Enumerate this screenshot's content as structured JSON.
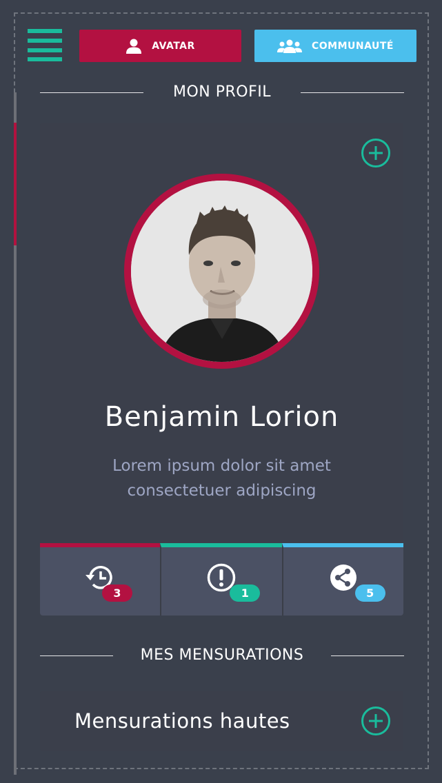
{
  "topbar": {
    "avatar_label": "AVATAR",
    "community_label": "COMMUNAUTÉ"
  },
  "profile": {
    "section_title": "MON PROFIL",
    "name": "Benjamin Lorion",
    "bio_line1": "Lorem ipsum dolor sit amet",
    "bio_line2": "consectetuer adipiscing"
  },
  "stats": [
    {
      "icon": "history-icon",
      "count": "3",
      "color": "#b31141"
    },
    {
      "icon": "alert-icon",
      "count": "1",
      "color": "#1abc9c"
    },
    {
      "icon": "share-icon",
      "count": "5",
      "color": "#4bbfed"
    }
  ],
  "measurements": {
    "section_title": "MES MENSURATIONS",
    "item_label": "Mensurations hautes"
  },
  "colors": {
    "background": "#3a404c",
    "card": "#3b3f4b",
    "accent_red": "#b31141",
    "accent_green": "#1abc9c",
    "accent_blue": "#4bbfed"
  }
}
